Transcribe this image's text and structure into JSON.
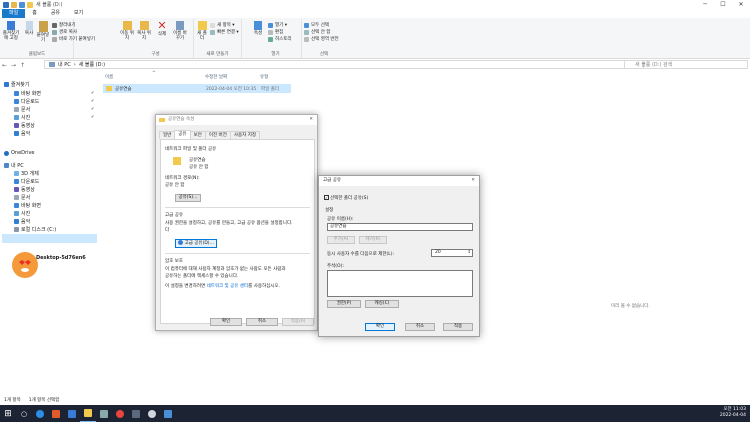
{
  "window": {
    "title": "새 볼륨 (D:)",
    "min": "─",
    "max": "☐",
    "close": "✕"
  },
  "tabs": [
    "파일",
    "홈",
    "공유",
    "보기"
  ],
  "ribbon": {
    "clipboard": {
      "label": "클립보드",
      "pin": "즐겨찾기에 고정",
      "copy": "복사",
      "paste": "붙여넣기",
      "cut": "잘라내기",
      "copy_path": "경로 복사",
      "paste_shortcut": "바로 가기 붙여넣기"
    },
    "organize": {
      "label": "구성",
      "move": "이동 위치",
      "copy_to": "복사 위치",
      "delete": "삭제",
      "rename": "이름 바꾸기"
    },
    "new": {
      "label": "새로 만들기",
      "new_folder": "새 폴더",
      "new_item": "새 항목 ▾",
      "easy_access": "빠른 연결 ▾"
    },
    "open": {
      "label": "열기",
      "properties": "속성",
      "open": "열기 ▾",
      "edit": "편집",
      "history": "히스토리"
    },
    "select": {
      "label": "선택",
      "select_all": "모두 선택",
      "select_none": "선택 안 함",
      "invert": "선택 영역 반전"
    }
  },
  "address": {
    "back": "←",
    "forward": "→",
    "up_arrow": "↑",
    "path": [
      "내 PC",
      "새 볼륨 (D:)"
    ],
    "search_placeholder": "새 볼륨 (D:) 검색"
  },
  "nav": {
    "quick": "즐겨찾기",
    "items": [
      "바탕 화면",
      "다운로드",
      "문서",
      "사진",
      "동영상",
      "음악"
    ],
    "onedrive": "OneDrive",
    "pc": "내 PC",
    "pc_items": [
      "3D 개체",
      "다운로드",
      "동영상",
      "문서",
      "바탕 화면",
      "사진",
      "음악",
      "로컬 디스크 (C:)"
    ],
    "network": "Desktop-5d76en6"
  },
  "columns": {
    "name": "이름",
    "date": "수정한 날짜",
    "type": "유형"
  },
  "files": [
    {
      "name": "공유연습",
      "date": "2022-04-04 오전 10:35",
      "type": "파일 폴더"
    }
  ],
  "empty_text": "미리 볼 수 없습니다.",
  "status": {
    "count": "1개 항목",
    "selected": "1개 항목 선택함"
  },
  "clock": {
    "time": "오전 11:03",
    "date": "2022-04-04"
  },
  "props": {
    "title": "공유연습 속성",
    "tabs": [
      "일반",
      "공유",
      "보안",
      "이전 버전",
      "사용자 지정"
    ],
    "net_share_title": "네트워크 파일 및 폴더 공유",
    "folder_name": "공유연습",
    "folder_state": "공유 안 함",
    "net_path_label": "네트워크 경로(N):",
    "net_path_value": "공유 안 함",
    "share_btn": "공유(S)...",
    "adv_title": "고급 공유",
    "adv_desc": "사용 권한을 설정하고, 공유를 만들고, 고급 공유 옵션을 설정합니다.",
    "adv_desc2": "다",
    "adv_btn": "고급 공유(D)...",
    "pw_title": "암호 보호",
    "pw_desc1": "이 컴퓨터에 대해 사용자 계정과 암호가 없는 사람도 모든 사람과",
    "pw_desc2": "공유하는 폴더에 액세스할 수 있습니다.",
    "pw_desc3": "이 설정을 변경하려면",
    "pw_link": "네트워크 및 공유 센터",
    "pw_desc4": "를 사용하십시오.",
    "ok": "확인",
    "cancel": "취소",
    "apply": "적용(A)"
  },
  "adv": {
    "title": "고급 공유",
    "close": "✕",
    "share_check": "선택한 폴더 공유(S)",
    "check_mark": "✓",
    "settings": "설정",
    "share_name_label": "공유 이름(H):",
    "share_name": "공유연습",
    "add": "추가(A)",
    "remove": "제거(R)",
    "limit_label": "동시 사용자 수를 다음으로 제한(L):",
    "limit_value": "20",
    "comment_label": "주석(O):",
    "perm": "권한(P)",
    "cache": "캐싱(C)",
    "ok": "확인",
    "cancel": "취소",
    "apply": "적용"
  }
}
